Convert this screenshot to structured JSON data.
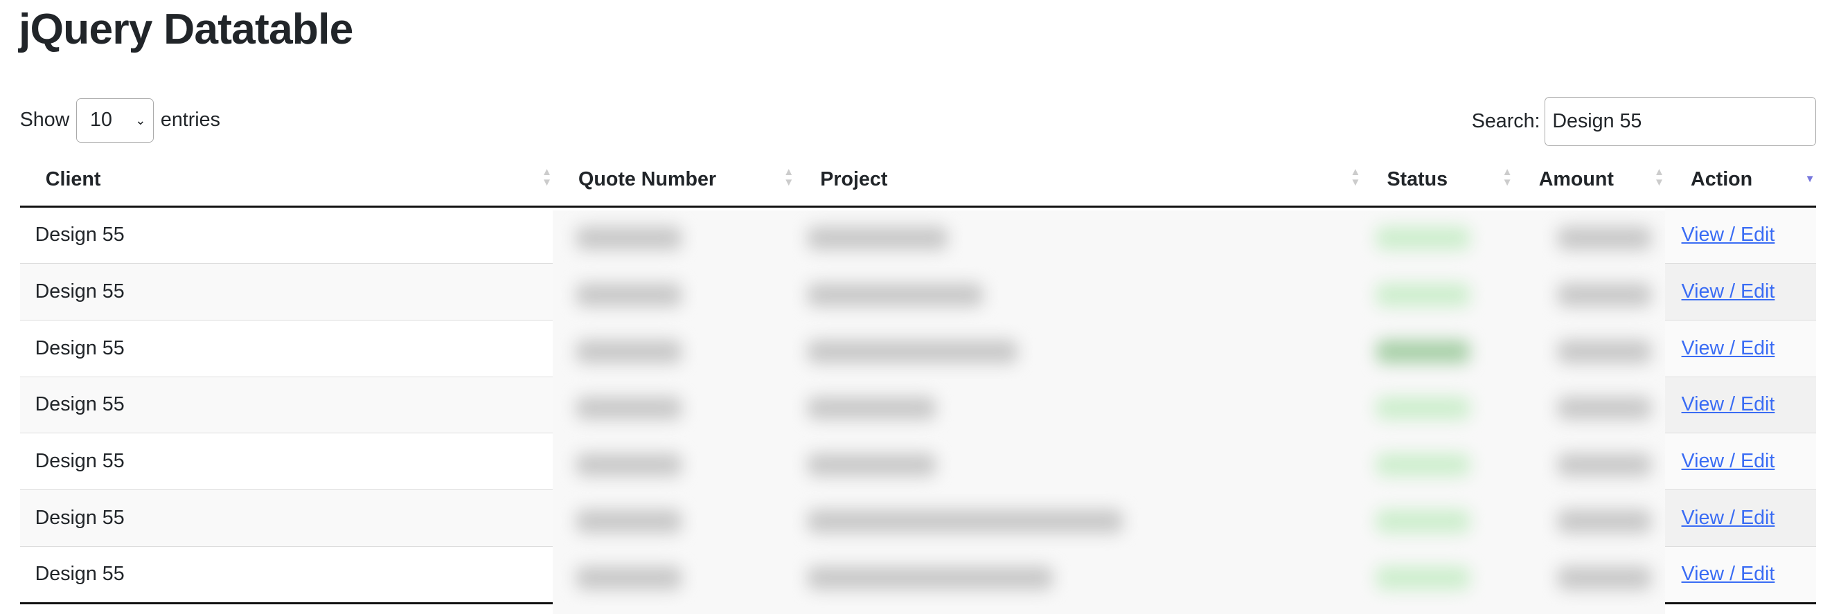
{
  "page": {
    "title": "jQuery Datatable"
  },
  "length": {
    "show_label": "Show",
    "value": "10",
    "entries_label": "entries"
  },
  "search": {
    "label": "Search:",
    "value": "Design 55"
  },
  "columns": [
    {
      "label": "Client",
      "sort": "none"
    },
    {
      "label": "Quote Number",
      "sort": "none"
    },
    {
      "label": "Project",
      "sort": "none"
    },
    {
      "label": "Status",
      "sort": "none"
    },
    {
      "label": "Amount",
      "sort": "none"
    },
    {
      "label": "Action",
      "sort": "descending"
    }
  ],
  "rows": [
    {
      "client": "Design 55",
      "action": "View / Edit"
    },
    {
      "client": "Design 55",
      "action": "View / Edit"
    },
    {
      "client": "Design 55",
      "action": "View / Edit"
    },
    {
      "client": "Design 55",
      "action": "View / Edit"
    },
    {
      "client": "Design 55",
      "action": "View / Edit"
    },
    {
      "client": "Design 55",
      "action": "View / Edit"
    },
    {
      "client": "Design 55",
      "action": "View / Edit"
    }
  ],
  "colors": {
    "link": "#3a6cf4",
    "sort_active": "#7777dd",
    "status_blurred": "#cdeecd"
  }
}
